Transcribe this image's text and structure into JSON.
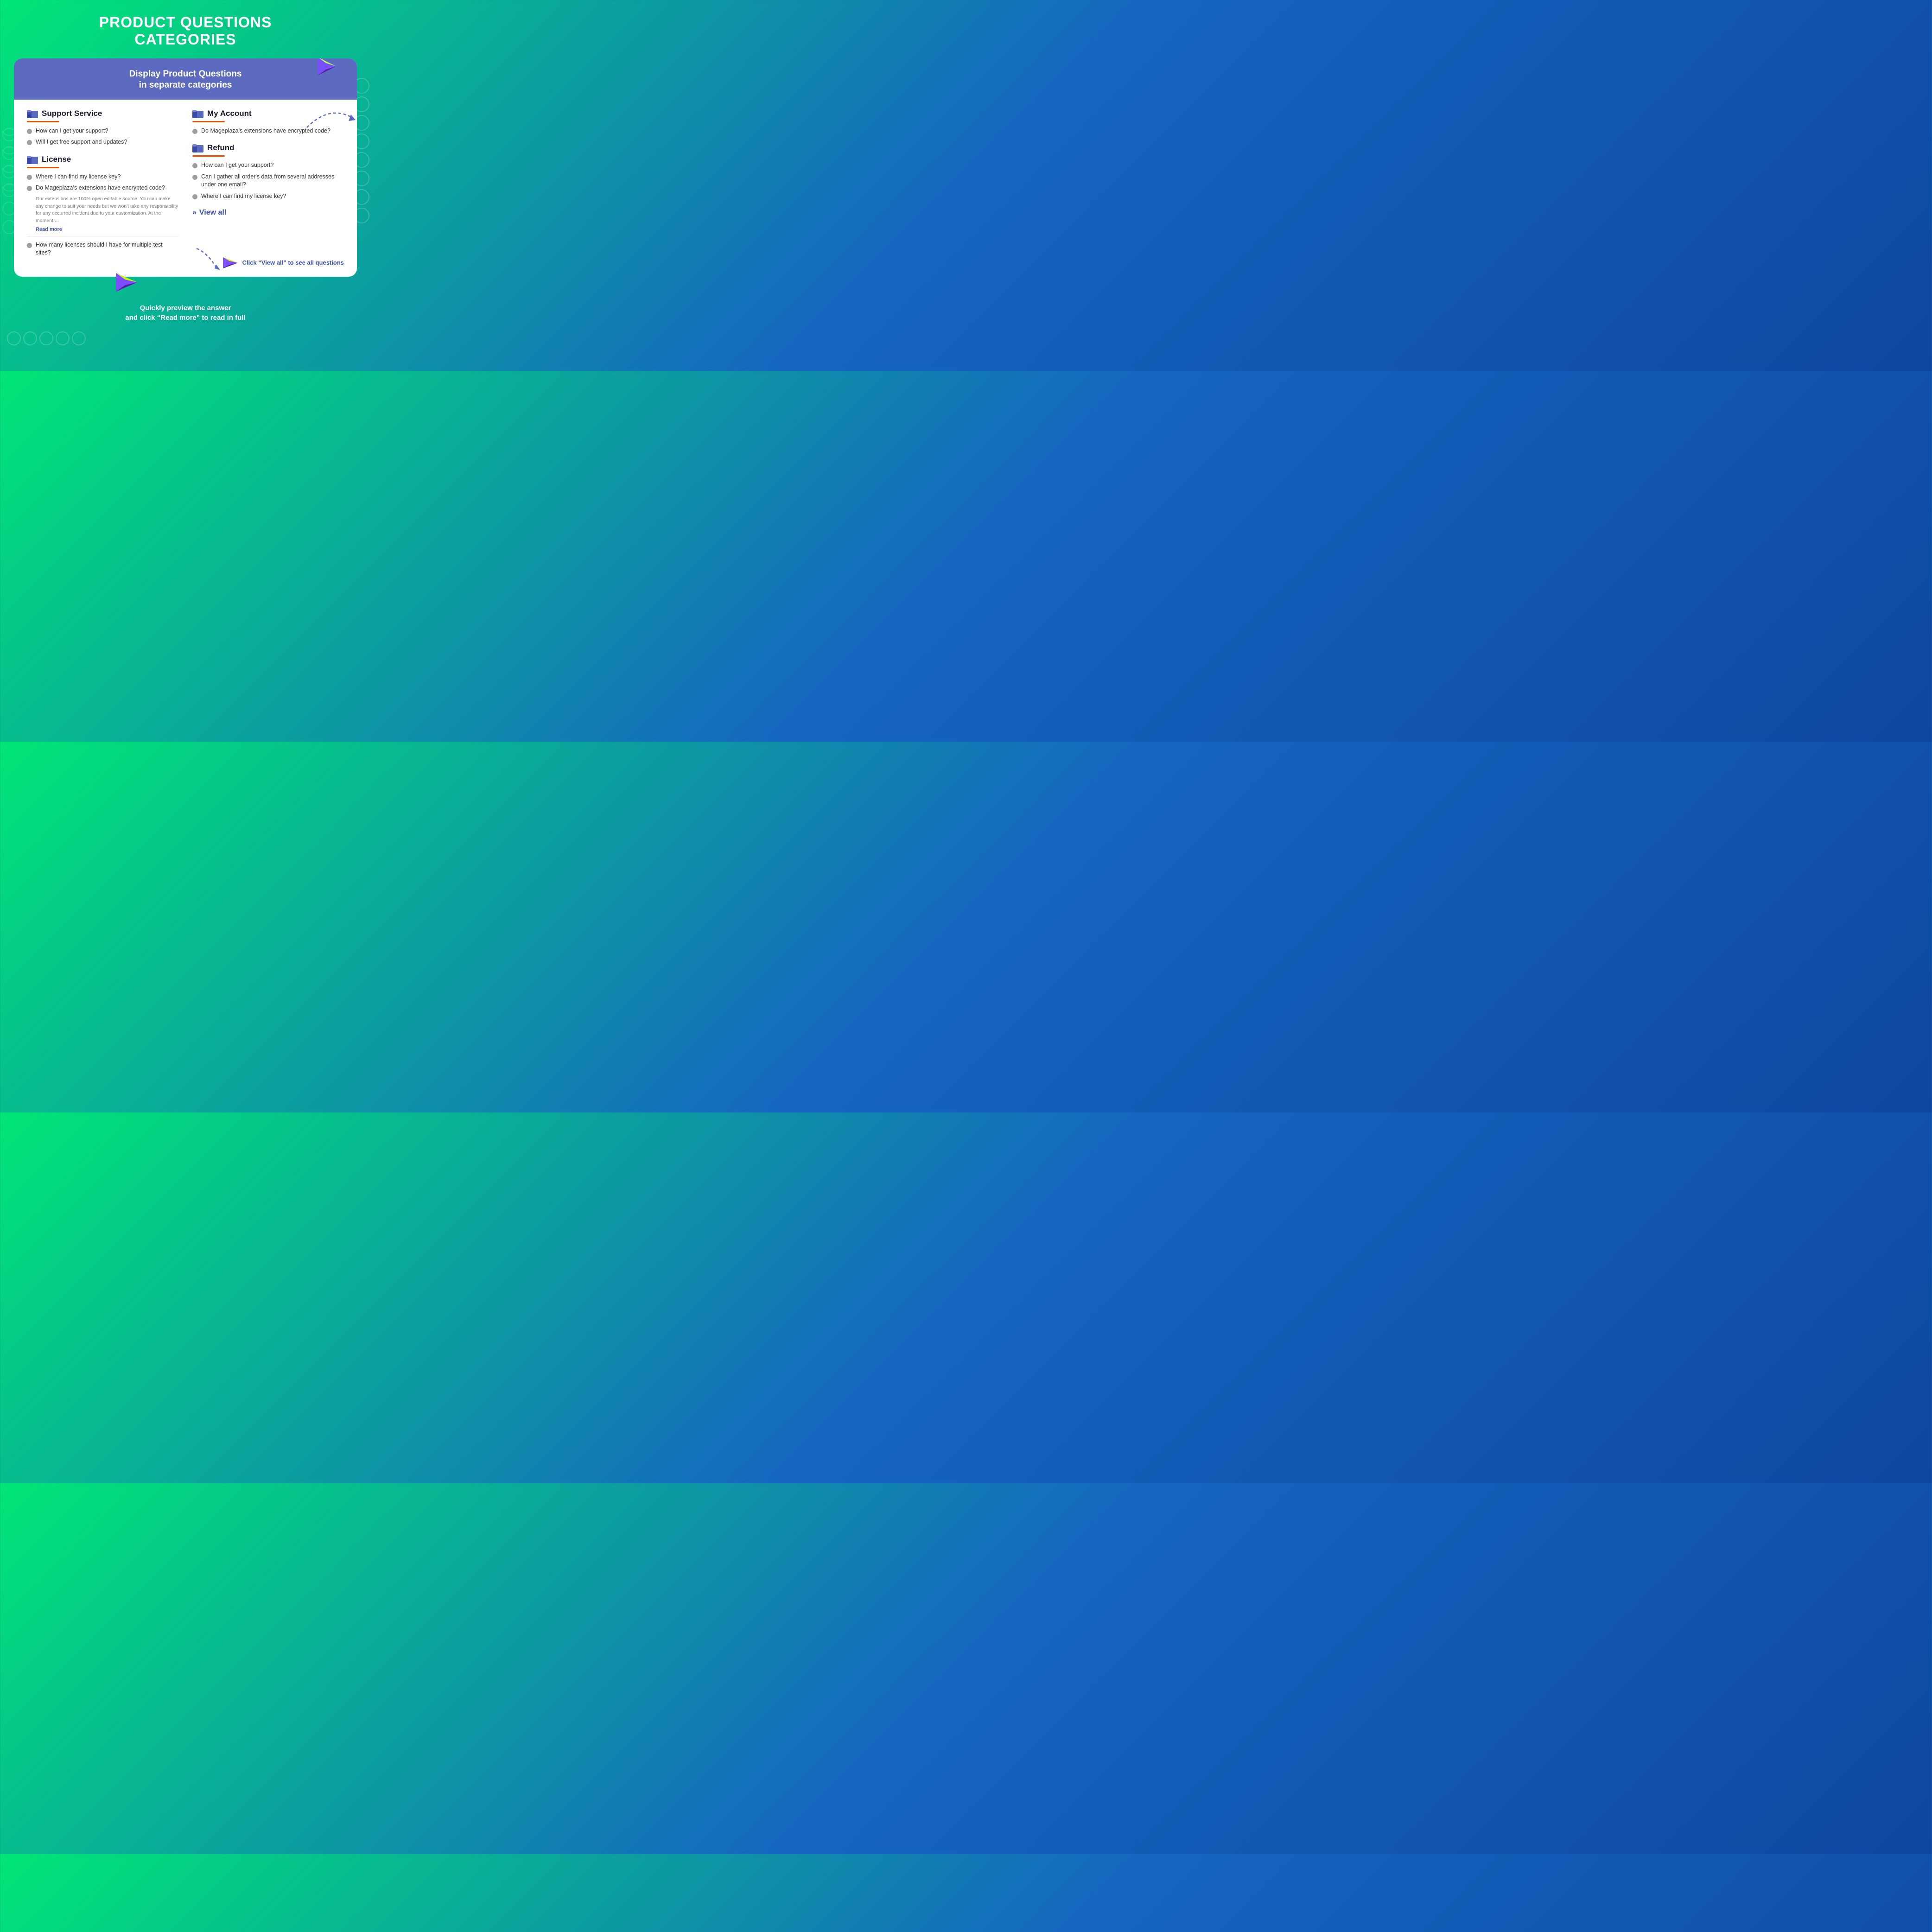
{
  "page": {
    "title_line1": "PRODUCT QUESTIONS",
    "title_line2": "CATEGORIES",
    "background_colors": [
      "#00e676",
      "#1565c0",
      "#0d47a1"
    ]
  },
  "card": {
    "header": {
      "title_line1": "Display Product Questions",
      "title_line2": "in separate categories"
    },
    "categories": [
      {
        "id": "support-service",
        "title": "Support Service",
        "questions": [
          "How can I get your support?",
          "Will I get free support and updates?"
        ],
        "answer_preview": null,
        "read_more": null,
        "extra_questions": []
      },
      {
        "id": "my-account",
        "title": "My Account",
        "questions": [
          "Do Mageplaza's extensions have encrypted code?"
        ],
        "answer_preview": null,
        "read_more": null,
        "extra_questions": []
      },
      {
        "id": "license",
        "title": "License",
        "questions": [
          "Where I can find my license key?",
          "Do Mageplaza's extensions have encrypted code?"
        ],
        "answer_preview": "Our extensions are 100% open editable source. You can make any change to suit your needs but we won't take any responsibility for any occurred incident due to your customization. At the moment ...",
        "read_more": "Read more",
        "extra_questions": [
          "How many licenses should I have for multiple test sites?"
        ]
      },
      {
        "id": "refund",
        "title": "Refund",
        "questions": [
          "How can I get your support?",
          "Can I gather all order's data from several addresses under one email?",
          "Where I can find my license key?"
        ],
        "answer_preview": null,
        "read_more": null,
        "extra_questions": []
      }
    ],
    "view_all_label": "View all",
    "annotation_text": "Click “View all”\nto see all questions"
  },
  "footer": {
    "text_line1": "Quickly preview the answer",
    "text_line2": "and click “Read more” to read in full"
  }
}
